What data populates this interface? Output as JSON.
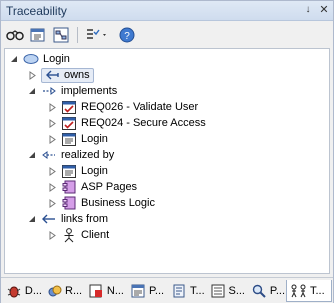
{
  "window": {
    "title": "Traceability"
  },
  "toolbar": {
    "items": [
      "binoculars-icon",
      "properties-icon",
      "diagram-icon",
      "filter-icon",
      "help-icon"
    ]
  },
  "tree": {
    "root": "Login",
    "owns": "owns",
    "implements": "implements",
    "req1": "REQ026 - Validate User",
    "req2": "REQ024 - Secure Access",
    "impl_login": "Login",
    "realized_by": "realized by",
    "rb_login": "Login",
    "rb_asp": "ASP Pages",
    "rb_logic": "Business Logic",
    "links_from": "links from",
    "client": "Client"
  },
  "tabs": [
    {
      "label": "D..."
    },
    {
      "label": "R..."
    },
    {
      "label": "N..."
    },
    {
      "label": "P..."
    },
    {
      "label": "T..."
    },
    {
      "label": "S..."
    },
    {
      "label": "P..."
    },
    {
      "label": "T..."
    }
  ]
}
